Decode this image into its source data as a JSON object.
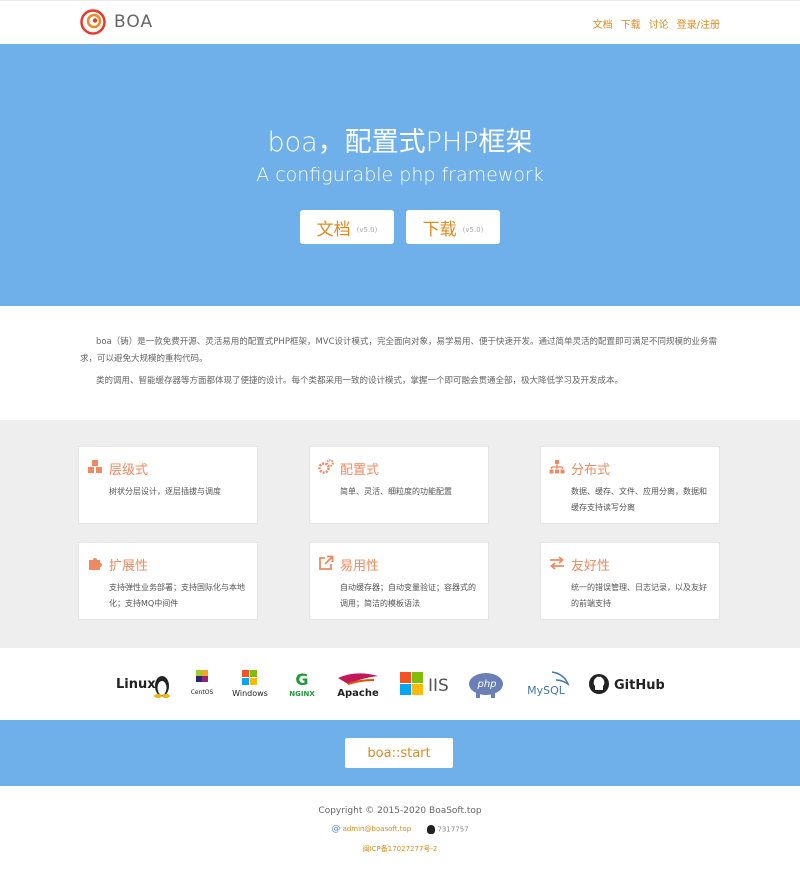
{
  "header": {
    "brand": "BOA",
    "nav": [
      "文档",
      "下载",
      "讨论",
      "登录/注册"
    ]
  },
  "hero": {
    "title": "boa，配置式PHP框架",
    "subtitle": "A configurable php framework",
    "docs_button": {
      "label": "文档",
      "version": "(v5.0)"
    },
    "download_button": {
      "label": "下载",
      "version": "(v5.0)"
    }
  },
  "intro": {
    "p1": "boa（铸）是一款免费开源、灵活易用的配置式PHP框架，MVC设计模式，完全面向对象，易学易用、便于快速开发。通过简单灵活的配置即可满足不同规模的业务需求，可以避免大规模的重构代码。",
    "p2": "类的调用、智能缓存器等方面都体现了便捷的设计。每个类都采用一致的设计模式，掌握一个即可融会贯通全部，极大降低学习及开发成本。"
  },
  "features": [
    {
      "title": "层级式",
      "desc": "树状分层设计，逐层插拔与调度",
      "icon": "cubes-icon"
    },
    {
      "title": "配置式",
      "desc": "简单、灵活、细粒度的功能配置",
      "icon": "gears-icon"
    },
    {
      "title": "分布式",
      "desc": "数据、缓存、文件、应用分离，数据和缓存支持读写分离",
      "icon": "sitemap-icon"
    },
    {
      "title": "扩展性",
      "desc": "支持弹性业务部署；支持国际化与本地化；支持MQ中间件",
      "icon": "puzzle-icon"
    },
    {
      "title": "易用性",
      "desc": "自动缓存器；自动变量验证；容器式的调用；简洁的模板语法",
      "icon": "external-link-icon"
    },
    {
      "title": "友好性",
      "desc": "统一的错误管理、日志记录，以及友好的前端支持",
      "icon": "exchange-icon"
    }
  ],
  "logos": [
    "Linux",
    "CentOS",
    "Windows",
    "NGINX",
    "Apache",
    "IIS",
    "php",
    "MySQL",
    "GitHub"
  ],
  "start": {
    "label": "boa::start"
  },
  "footer": {
    "copyright": "Copyright © 2015-2020 BoaSoft.top",
    "email": "admin@boasoft.top",
    "qq": "7317757",
    "icp": "闽ICP备17027277号-2"
  },
  "colors": {
    "accent": "#e08a1e",
    "hero_bg": "#6fb0ea",
    "feature_title": "#ef8a60"
  }
}
